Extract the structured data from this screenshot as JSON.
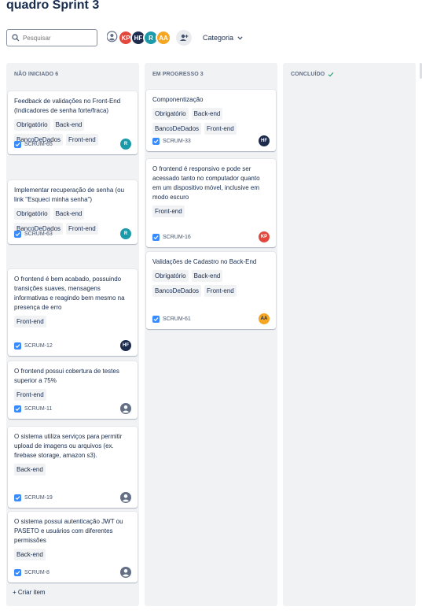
{
  "board": {
    "title": "quadro Sprint 3"
  },
  "toolbar": {
    "search_placeholder": "Pesquisar",
    "category_label": "Categoria",
    "avatars": [
      {
        "initials": "",
        "color": "#ffffff",
        "kind": "person-icon"
      },
      {
        "initials": "KP",
        "color": "#e2483d"
      },
      {
        "initials": "HF",
        "color": "#1d2b4d"
      },
      {
        "initials": "R",
        "color": "#1d9aaa"
      },
      {
        "initials": "AA",
        "color": "#f5a623"
      }
    ]
  },
  "columns": [
    {
      "title": "NÃO INICIADO 6",
      "create_label": "+ Criar item",
      "cards": [
        {
          "title": "Feedback de validações no Front-End (Indicadores de senha forte/fraca)",
          "labels": [
            "Obrigatório",
            "Back-end",
            "BancoDeDados",
            "Front-end"
          ],
          "key": "SCRUM-65",
          "assignee": "R",
          "assignee_color": "#1d9aaa"
        },
        {
          "title": "Implementar recuperação de senha (ou link \"Esqueci minha senha\")",
          "labels": [
            "Obrigatório",
            "Back-end",
            "BancoDeDados",
            "Front-end"
          ],
          "key": "SCRUM-63",
          "assignee": "R",
          "assignee_color": "#1d9aaa"
        },
        {
          "title": "O frontend é bem acabado, possuindo transições suaves, mensagens informativas e reagindo bem mesmo na presença de erro",
          "labels": [
            "Front-end"
          ],
          "key": "SCRUM-12",
          "assignee": "HF",
          "assignee_color": "#1d2b4d"
        },
        {
          "title": "O frontend possui cobertura de testes superior a 75%",
          "labels": [
            "Front-end"
          ],
          "key": "SCRUM-11",
          "assignee": "",
          "assignee_color": ""
        },
        {
          "title": "O sistema utiliza serviços para permitir upload de imagens ou arquivos (ex. firebase storage, amazon s3).",
          "labels": [
            "Back-end"
          ],
          "key": "SCRUM-19",
          "assignee": "",
          "assignee_color": ""
        },
        {
          "title": "O sistema possui autenticação JWT ou PASETO e usuários com diferentes permissões",
          "labels": [
            "Back-end"
          ],
          "key": "SCRUM-8",
          "assignee": "",
          "assignee_color": ""
        }
      ]
    },
    {
      "title": "EM PROGRESSO 3",
      "cards": [
        {
          "title": "Componentização",
          "labels": [
            "Obrigatório",
            "Back-end",
            "BancoDeDados",
            "Front-end"
          ],
          "key": "SCRUM-33",
          "assignee": "HF",
          "assignee_color": "#1d2b4d"
        },
        {
          "title": "O frontend é responsivo e pode ser acessado tanto no computador quanto em um dispositivo móvel, inclusive em modo escuro",
          "labels": [
            "Front-end"
          ],
          "key": "SCRUM-16",
          "assignee": "KP",
          "assignee_color": "#e2483d"
        },
        {
          "title": "Validações de Cadastro no Back-End",
          "labels": [
            "Obrigatório",
            "Back-end",
            "BancoDeDados",
            "Front-end"
          ],
          "key": "SCRUM-61",
          "assignee": "AA",
          "assignee_color": "#f5a623"
        }
      ]
    },
    {
      "title": "CONCLUÍDO",
      "cards": []
    }
  ]
}
